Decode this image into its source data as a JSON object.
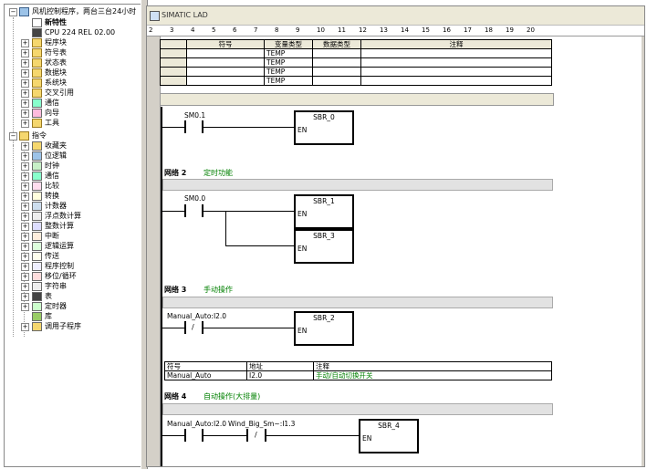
{
  "tree": {
    "root": "风机控制程序，两台三台24小时",
    "items": [
      "新特性",
      "CPU 224 REL 02.00",
      "程序块",
      "符号表",
      "状态表",
      "数据块",
      "系统块",
      "交叉引用",
      "通信",
      "向导",
      "工具"
    ],
    "instr_group": "指令",
    "instr_items": [
      "收藏夹",
      "位逻辑",
      "时钟",
      "通信",
      "比较",
      "转换",
      "计数器",
      "浮点数计算",
      "整数计算",
      "中断",
      "逻辑运算",
      "传送",
      "程序控制",
      "移位/循环",
      "字符串",
      "表",
      "定时器",
      "库",
      "调用子程序"
    ]
  },
  "editor": {
    "title": "SIMATIC LAD",
    "ruler": [
      "2",
      "3",
      "4",
      "5",
      "6",
      "7",
      "8",
      "9",
      "10",
      "11",
      "12",
      "13",
      "14",
      "15",
      "16",
      "17",
      "18",
      "19",
      "20"
    ],
    "var_table": {
      "headers": [
        "符号",
        "变量类型",
        "数据类型",
        "注释"
      ],
      "rows": [
        "TEMP",
        "TEMP",
        "TEMP",
        "TEMP"
      ]
    },
    "network1": {
      "contact": "SM0.1",
      "box": "SBR_0",
      "en": "EN"
    },
    "network2": {
      "label": "网络 2",
      "comment": "定时功能",
      "contact": "SM0.0",
      "box1": "SBR_1",
      "box2": "SBR_3",
      "en": "EN"
    },
    "network3": {
      "label": "网络 3",
      "comment": "手动操作",
      "contact": "Manual_Auto:I2.0",
      "neg": "/",
      "box": "SBR_2",
      "en": "EN",
      "sym_table": {
        "headers": [
          "符号",
          "地址",
          "注释"
        ],
        "row": [
          "Manual_Auto",
          "I2.0",
          "手动/自动切换开关"
        ]
      }
    },
    "network4": {
      "label": "网络 4",
      "comment": "自动操作(大排量)",
      "contact1": "Manual_Auto:I2.0",
      "contact2": "Wind_Big_Sm~:I1.3",
      "neg": "/",
      "box": "SBR_4",
      "en": "EN"
    }
  }
}
